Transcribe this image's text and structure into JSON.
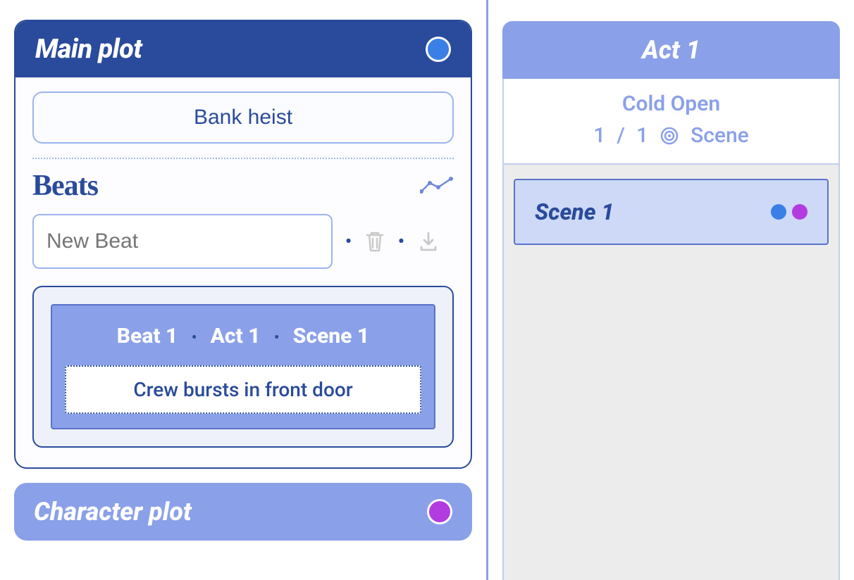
{
  "main_plot": {
    "header": "Main plot",
    "color": "#3a7fe6",
    "title": "Bank heist",
    "beats_label": "Beats",
    "new_beat_placeholder": "New Beat",
    "beat": {
      "beat_label": "Beat 1",
      "act_label": "Act 1",
      "scene_label": "Scene 1",
      "description": "Crew bursts in front door"
    }
  },
  "character_plot": {
    "header": "Character plot",
    "color": "#b23ce0"
  },
  "act_panel": {
    "header": "Act 1",
    "subtitle": "Cold Open",
    "current": "1",
    "total": "1",
    "unit": "Scene",
    "scene": {
      "title": "Scene 1",
      "dots": [
        "#3a7fe6",
        "#b23ce0"
      ]
    }
  }
}
